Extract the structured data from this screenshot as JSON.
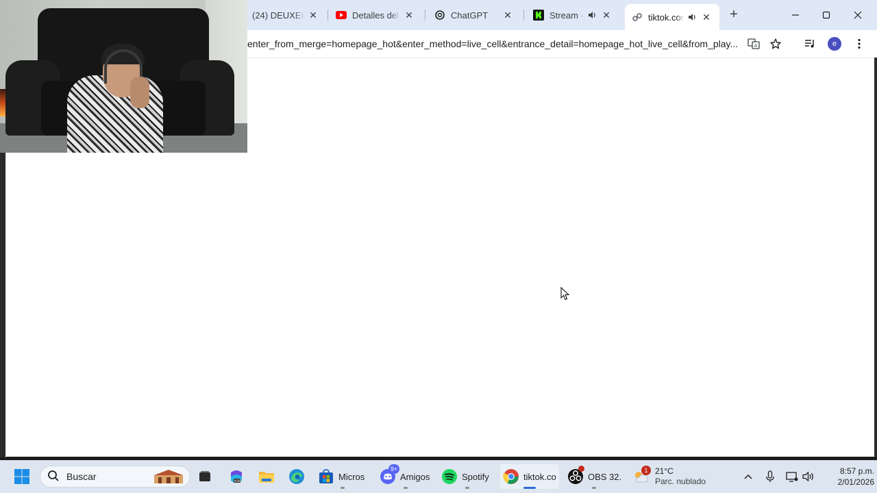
{
  "browser": {
    "tabs": [
      {
        "title": "(24) DEUXER",
        "icon": "tab-favicon",
        "active": false
      },
      {
        "title": "Detalles del v",
        "icon": "youtube-icon",
        "active": false
      },
      {
        "title": "ChatGPT",
        "icon": "chatgpt-icon",
        "active": false
      },
      {
        "title": "Stream - K",
        "icon": "kick-icon",
        "active": false,
        "audio": true
      },
      {
        "title": "tiktok.com",
        "icon": "tiktok-loading-icon",
        "active": true,
        "audio": true
      }
    ],
    "new_tab_label": "+",
    "url": "enter_from_merge=homepage_hot&enter_method=live_cell&entrance_detail=homepage_hot_live_cell&from_play...",
    "profile_initial": "e"
  },
  "taskbar": {
    "search_placeholder": "Buscar",
    "apps": [
      {
        "label": "",
        "icon": "task-view-icon"
      },
      {
        "label": "",
        "icon": "m365-copilot-icon"
      },
      {
        "label": "",
        "icon": "file-explorer-icon"
      },
      {
        "label": "",
        "icon": "edge-icon"
      },
      {
        "label": "Micros",
        "icon": "microsoft-store-icon"
      },
      {
        "label": "Amigos",
        "icon": "discord-icon",
        "badge": "9+"
      },
      {
        "label": "Spotify",
        "icon": "spotify-icon"
      },
      {
        "label": "tiktok.co",
        "icon": "chrome-icon",
        "active": true
      },
      {
        "label": "OBS 32.",
        "icon": "obs-icon"
      }
    ],
    "weather": {
      "temp": "21°C",
      "condition": "Parc. nublado",
      "badge": "1"
    },
    "clock": {
      "time": "8:57 p.m.",
      "date": "2/01/2026"
    }
  },
  "colors": {
    "tabstrip": "#dfe8f6",
    "taskbar": "#dde6f0",
    "accent": "#2c6ad6"
  }
}
